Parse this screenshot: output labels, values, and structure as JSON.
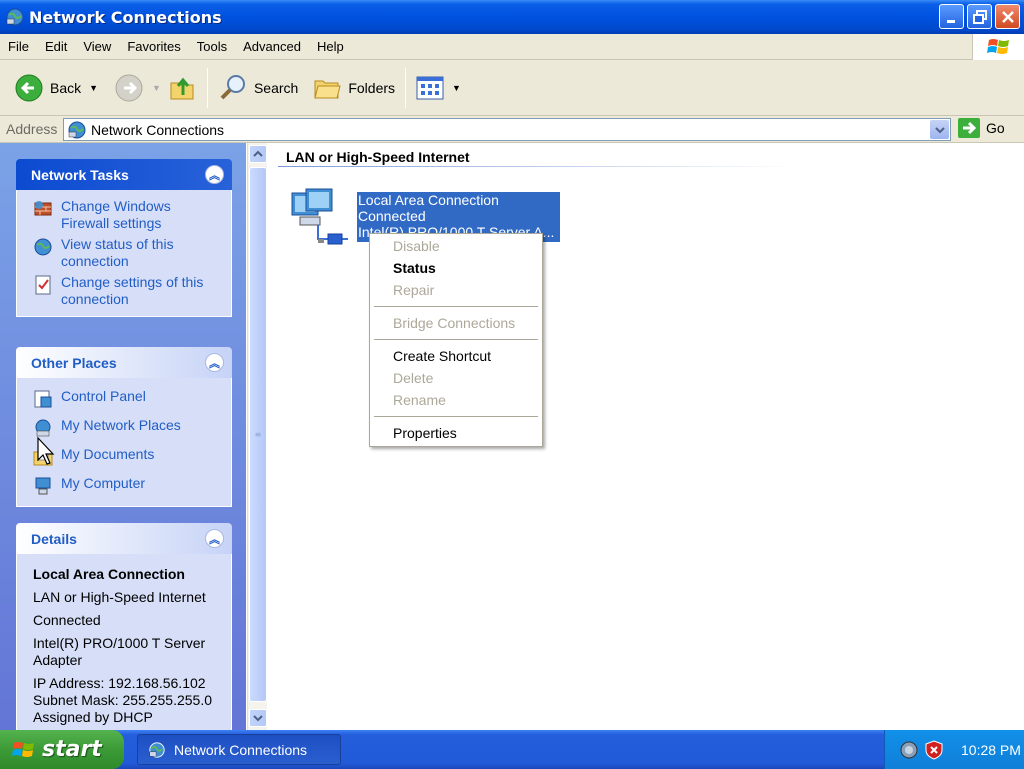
{
  "window": {
    "title": "Network Connections"
  },
  "menubar": {
    "items": [
      "File",
      "Edit",
      "View",
      "Favorites",
      "Tools",
      "Advanced",
      "Help"
    ]
  },
  "toolbar": {
    "back_label": "Back",
    "search_label": "Search",
    "folders_label": "Folders"
  },
  "address": {
    "label": "Address",
    "value": "Network Connections",
    "go_label": "Go"
  },
  "taskpane": {
    "network_tasks": {
      "title": "Network Tasks",
      "items": [
        {
          "label": "Change Windows Firewall settings",
          "icon": "firewall-icon"
        },
        {
          "label": "View status of this connection",
          "icon": "network-status-icon"
        },
        {
          "label": "Change settings of this connection",
          "icon": "properties-icon"
        }
      ]
    },
    "other_places": {
      "title": "Other Places",
      "items": [
        {
          "label": "Control Panel",
          "icon": "control-panel-icon"
        },
        {
          "label": "My Network Places",
          "icon": "network-places-icon"
        },
        {
          "label": "My Documents",
          "icon": "documents-folder-icon"
        },
        {
          "label": "My Computer",
          "icon": "computer-icon"
        }
      ]
    },
    "details": {
      "title": "Details",
      "name": "Local Area Connection",
      "type": "LAN or High-Speed Internet",
      "status": "Connected",
      "device": "Intel(R) PRO/1000 T Server Adapter",
      "ip": "IP Address: 192.168.56.102",
      "subnet": "Subnet Mask: 255.255.255.0",
      "assigned": "Assigned by DHCP"
    }
  },
  "content": {
    "group_title": "LAN or High-Speed Internet",
    "connection": {
      "name": "Local Area Connection",
      "status": "Connected",
      "device": "Intel(R) PRO/1000 T Server A..."
    }
  },
  "context_menu": {
    "disable": "Disable",
    "status": "Status",
    "repair": "Repair",
    "bridge": "Bridge Connections",
    "create_shortcut": "Create Shortcut",
    "delete": "Delete",
    "rename": "Rename",
    "properties": "Properties"
  },
  "taskbar": {
    "start_label": "start",
    "task_label": "Network Connections",
    "clock": "10:28 PM"
  },
  "colors": {
    "titlebar": "#0052e0",
    "selection": "#316ac5",
    "taskpane_link": "#215dc6",
    "start_green": "#3c9b37"
  }
}
